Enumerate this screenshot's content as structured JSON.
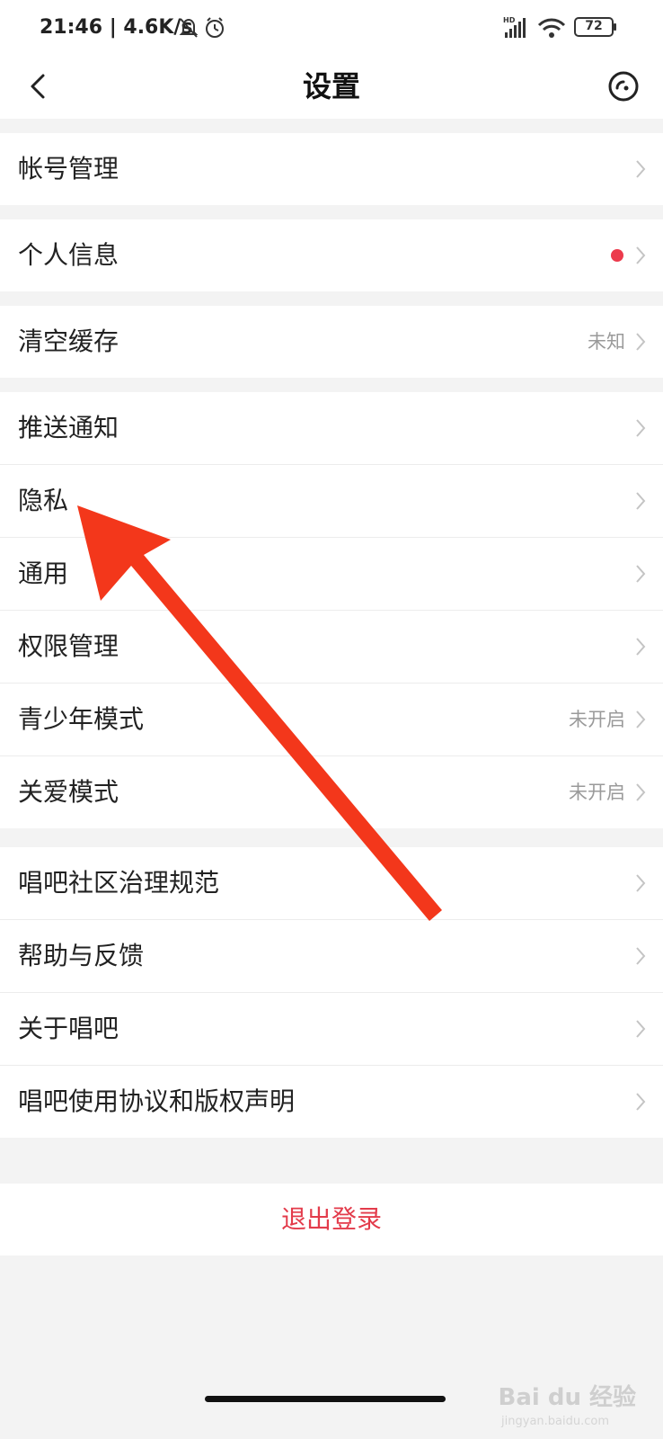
{
  "status_bar": {
    "time": "21:46 | 4.6K/s",
    "battery": "72",
    "network_label": "HD"
  },
  "nav": {
    "title": "设置"
  },
  "groups": [
    [
      {
        "label": "帐号管理"
      }
    ],
    [
      {
        "label": "个人信息",
        "badge": "red-dot"
      }
    ],
    [
      {
        "label": "清空缓存",
        "value": "未知"
      }
    ],
    [
      {
        "label": "推送通知"
      },
      {
        "label": "隐私"
      },
      {
        "label": "通用"
      },
      {
        "label": "权限管理"
      },
      {
        "label": "青少年模式",
        "value": "未开启"
      },
      {
        "label": "关爱模式",
        "value": "未开启"
      }
    ],
    [
      {
        "label": "唱吧社区治理规范"
      },
      {
        "label": "帮助与反馈"
      },
      {
        "label": "关于唱吧"
      },
      {
        "label": "唱吧使用协议和版权声明"
      }
    ]
  ],
  "logout_label": "退出登录",
  "watermark": {
    "brand": "Bai du 经验",
    "url": "jingyan.baidu.com"
  },
  "colors": {
    "accent_red": "#e33b4b",
    "dot_red": "#ec3a4c",
    "annotation_arrow": "#f3371b"
  },
  "icons": {
    "back": "chevron-left-icon",
    "scan": "scan-icon",
    "row_chevron": "chevron-right-icon"
  }
}
